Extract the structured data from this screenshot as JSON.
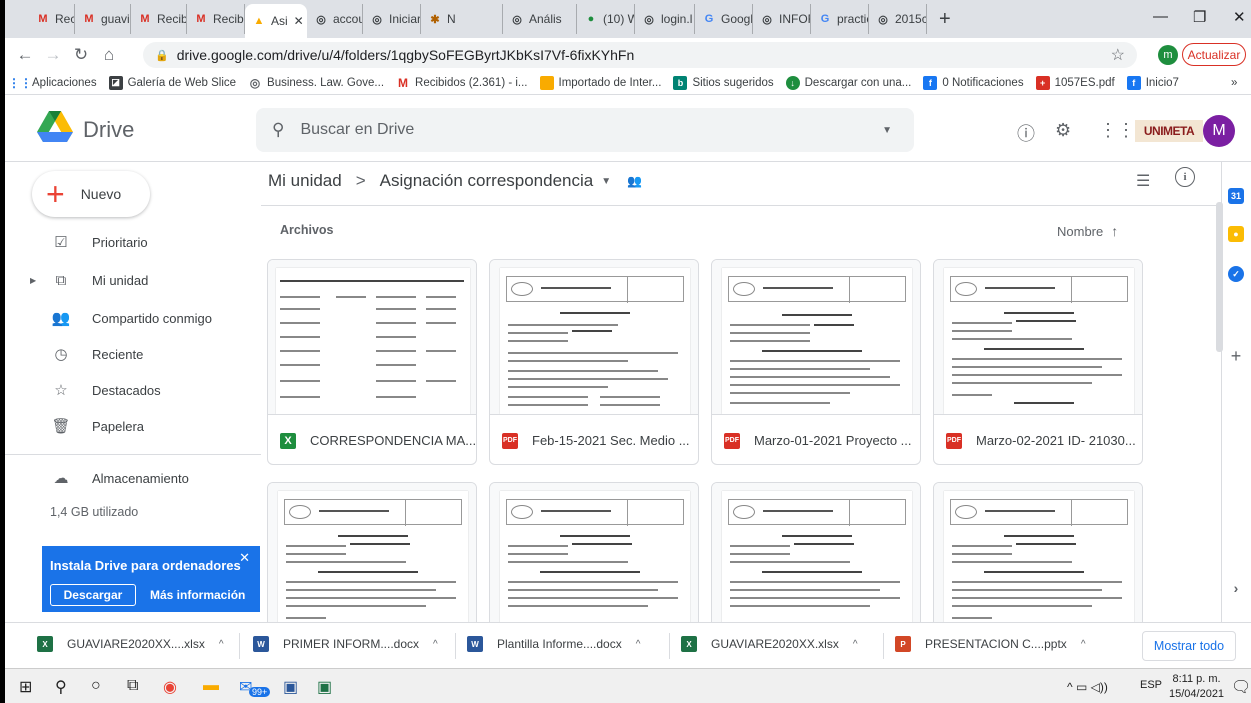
{
  "browser": {
    "tabs": [
      {
        "label": "Recibic",
        "icon": "gmail-icon",
        "active": false
      },
      {
        "label": "guavia",
        "icon": "gmail-icon",
        "active": false
      },
      {
        "label": "Recibic",
        "icon": "gmail-icon",
        "active": false
      },
      {
        "label": "Recibic",
        "icon": "gmail-icon",
        "active": false
      },
      {
        "label": "Asi",
        "icon": "drive-icon",
        "active": true
      },
      {
        "label": "accour",
        "icon": "globe-icon",
        "active": false
      },
      {
        "label": "Iniciar",
        "icon": "globe-icon",
        "active": false
      },
      {
        "label": "N",
        "icon": "cow-icon",
        "active": false
      },
      {
        "label": "Anális",
        "icon": "globe-icon",
        "active": false
      },
      {
        "label": "(10) W",
        "icon": "whatsapp-icon",
        "active": false
      },
      {
        "label": "login.l",
        "icon": "globe-icon",
        "active": false
      },
      {
        "label": "Googl",
        "icon": "google-icon",
        "active": false
      },
      {
        "label": "INFOR",
        "icon": "globe-icon",
        "active": false
      },
      {
        "label": "practic",
        "icon": "google-icon",
        "active": false
      },
      {
        "label": "2015c",
        "icon": "globe-icon",
        "active": false
      }
    ],
    "url": "drive.google.com/drive/u/4/folders/1qgbySoFEGByrtJKbKsI7Vf-6fixKYhFn",
    "profile_initial": "m",
    "update_label": "Actualizar",
    "bookmarks": [
      {
        "label": "Aplicaciones",
        "icon": "apps-grid-icon",
        "color": "#1a73e8"
      },
      {
        "label": "Galería de Web Slice",
        "icon": "webslice-icon",
        "color": "#3c4043"
      },
      {
        "label": "Business. Law. Gove...",
        "icon": "globe-icon",
        "color": "#5f6368"
      },
      {
        "label": "Recibidos (2.361) - i...",
        "icon": "gmail-icon",
        "color": "#d93025"
      },
      {
        "label": "Importado de Inter...",
        "icon": "folder-icon",
        "color": "#f9ab00"
      },
      {
        "label": "Sitios sugeridos",
        "icon": "bing-icon",
        "color": "#008373"
      },
      {
        "label": "Descargar con una...",
        "icon": "download-site-icon",
        "color": "#1e8e3e"
      },
      {
        "label": "0 Notificaciones",
        "icon": "facebook-icon",
        "color": "#1877f2"
      },
      {
        "label": "1057ES.pdf",
        "icon": "pdf-icon",
        "color": "#d93025"
      },
      {
        "label": "Inicio7",
        "icon": "facebook-icon",
        "color": "#1877f2"
      }
    ]
  },
  "drive": {
    "title": "Drive",
    "search_placeholder": "Buscar en Drive",
    "org_logo_text": "UNIMETA",
    "avatar_initial": "M",
    "new_label": "Nuevo",
    "nav": [
      {
        "label": "Prioritario",
        "icon": "check-square-icon"
      },
      {
        "label": "Mi unidad",
        "icon": "my-drive-icon"
      },
      {
        "label": "Compartido conmigo",
        "icon": "people-icon"
      },
      {
        "label": "Reciente",
        "icon": "clock-icon"
      },
      {
        "label": "Destacados",
        "icon": "star-icon"
      },
      {
        "label": "Papelera",
        "icon": "trash-icon"
      },
      {
        "label": "Almacenamiento",
        "icon": "cloud-icon"
      }
    ],
    "storage_used": "1,4 GB utilizado",
    "install_banner": {
      "title": "Instala Drive para ordenadores",
      "download": "Descargar",
      "more": "Más información"
    },
    "breadcrumb": {
      "root": "Mi unidad",
      "current": "Asignación correspondencia"
    },
    "files_section": "Archivos",
    "sort_label": "Nombre",
    "files": [
      {
        "name": "CORRESPONDENCIA MA...",
        "type": "xlsx"
      },
      {
        "name": "Feb-15-2021 Sec. Medio ...",
        "type": "pdf"
      },
      {
        "name": "Marzo-01-2021 Proyecto ...",
        "type": "pdf"
      },
      {
        "name": "Marzo-02-2021 ID- 21030...",
        "type": "pdf"
      },
      {
        "name": "",
        "type": "pdf"
      },
      {
        "name": "",
        "type": "pdf"
      },
      {
        "name": "",
        "type": "pdf"
      },
      {
        "name": "",
        "type": "pdf"
      }
    ]
  },
  "downloads": {
    "items": [
      {
        "name": "GUAVIARE2020XX....xlsx",
        "icon": "excel-icon"
      },
      {
        "name": "PRIMER INFORM....docx",
        "icon": "word-icon"
      },
      {
        "name": "Plantilla Informe....docx",
        "icon": "word-icon"
      },
      {
        "name": "GUAVIARE2020XX.xlsx",
        "icon": "excel-icon"
      },
      {
        "name": "PRESENTACION C....pptx",
        "icon": "powerpoint-icon"
      }
    ],
    "show_all": "Mostrar todo"
  },
  "taskbar": {
    "lang": "ESP",
    "time": "8:11 p. m.",
    "date": "15/04/2021",
    "badge": "99+"
  }
}
